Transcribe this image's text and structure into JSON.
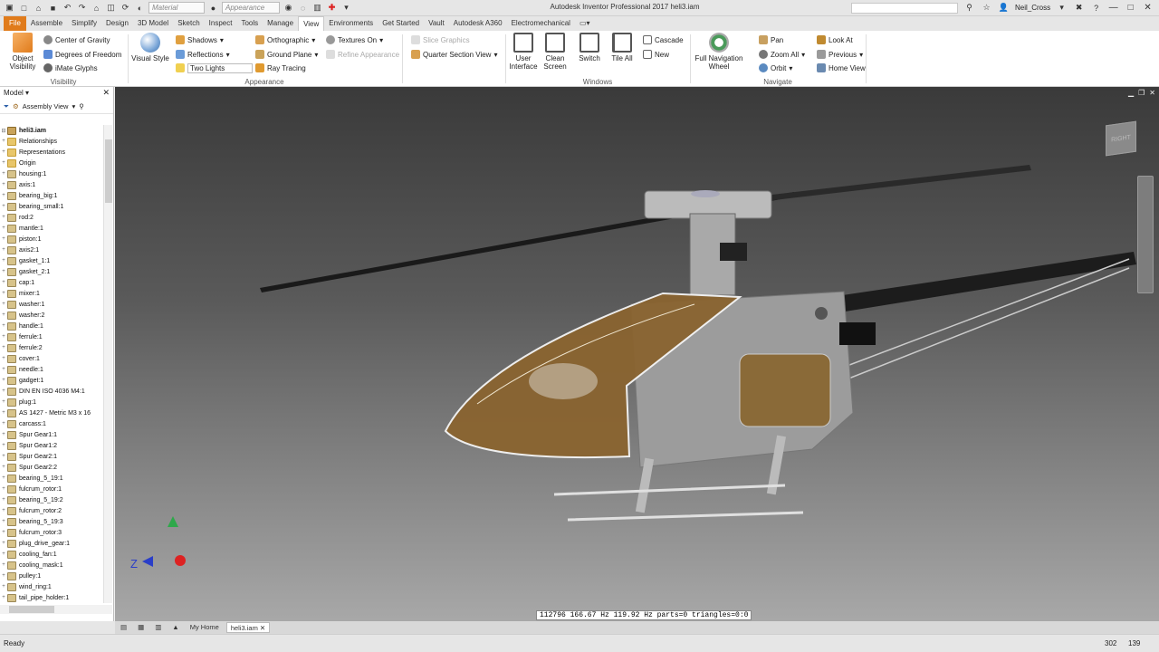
{
  "title_bar": {
    "material_placeholder": "Material",
    "appearance_placeholder": "Appearance",
    "app_title": "Autodesk Inventor Professional 2017    heli3.iam",
    "user_name": "Neil_Cross"
  },
  "menu": {
    "file": "File",
    "tabs": [
      "Assemble",
      "Simplify",
      "Design",
      "3D Model",
      "Sketch",
      "Inspect",
      "Tools",
      "Manage",
      "View",
      "Environments",
      "Get Started",
      "Vault",
      "Autodesk A360",
      "Electromechanical"
    ]
  },
  "ribbon": {
    "visibility": {
      "object_visibility": "Object Visibility",
      "center_of_gravity": "Center of Gravity",
      "degrees_of_freedom": "Degrees of Freedom",
      "imate_glyphs": "iMate Glyphs",
      "group": "Visibility"
    },
    "appearance": {
      "visual_style": "Visual Style",
      "shadows": "Shadows",
      "reflections": "Reflections",
      "two_lights": "Two Lights",
      "orthographic": "Orthographic",
      "ground_plane": "Ground Plane",
      "ray_tracing": "Ray Tracing",
      "textures_on": "Textures On",
      "refine_appearance": "Refine Appearance",
      "group": "Appearance"
    },
    "slice": {
      "slice_graphics": "Slice Graphics",
      "quarter_section": "Quarter Section View"
    },
    "windows": {
      "user_interface": "User Interface",
      "clean_screen": "Clean Screen",
      "switch": "Switch",
      "tile_all": "Tile All",
      "cascade": "Cascade",
      "new": "New",
      "group": "Windows"
    },
    "navigate": {
      "full_nav_wheel": "Full Navigation Wheel",
      "pan": "Pan",
      "zoom_all": "Zoom All",
      "orbit": "Orbit",
      "look_at": "Look At",
      "previous": "Previous",
      "home_view": "Home View",
      "group": "Navigate"
    }
  },
  "model_panel": {
    "title": "Model",
    "view_name": "Assembly View",
    "root": "heli3.iam",
    "items": [
      {
        "label": "Relationships",
        "icon": "folder"
      },
      {
        "label": "Representations",
        "icon": "folder"
      },
      {
        "label": "Origin",
        "icon": "folder"
      },
      {
        "label": "housing:1",
        "icon": "part"
      },
      {
        "label": "axis:1",
        "icon": "part"
      },
      {
        "label": "bearing_big:1",
        "icon": "part"
      },
      {
        "label": "bearing_small:1",
        "icon": "part"
      },
      {
        "label": "rod:2",
        "icon": "part"
      },
      {
        "label": "mantle:1",
        "icon": "part"
      },
      {
        "label": "piston:1",
        "icon": "part"
      },
      {
        "label": "axis2:1",
        "icon": "part"
      },
      {
        "label": "gasket_1:1",
        "icon": "part"
      },
      {
        "label": "gasket_2:1",
        "icon": "part"
      },
      {
        "label": "cap:1",
        "icon": "part"
      },
      {
        "label": "mixer:1",
        "icon": "part"
      },
      {
        "label": "washer:1",
        "icon": "part"
      },
      {
        "label": "washer:2",
        "icon": "part"
      },
      {
        "label": "handle:1",
        "icon": "part"
      },
      {
        "label": "ferrule:1",
        "icon": "part"
      },
      {
        "label": "ferrule:2",
        "icon": "part"
      },
      {
        "label": "cover:1",
        "icon": "part"
      },
      {
        "label": "needle:1",
        "icon": "part"
      },
      {
        "label": "gadget:1",
        "icon": "part"
      },
      {
        "label": "DIN EN ISO 4036 M4:1",
        "icon": "part"
      },
      {
        "label": "plug:1",
        "icon": "part"
      },
      {
        "label": "AS 1427 - Metric M3 x 16",
        "icon": "part"
      },
      {
        "label": "carcass:1",
        "icon": "part"
      },
      {
        "label": "Spur Gear1:1",
        "icon": "part"
      },
      {
        "label": "Spur Gear1:2",
        "icon": "part"
      },
      {
        "label": "Spur Gear2:1",
        "icon": "part"
      },
      {
        "label": "Spur Gear2:2",
        "icon": "part"
      },
      {
        "label": "bearing_5_19:1",
        "icon": "part"
      },
      {
        "label": "fulcrum_rotor:1",
        "icon": "part"
      },
      {
        "label": "bearing_5_19:2",
        "icon": "part"
      },
      {
        "label": "fulcrum_rotor:2",
        "icon": "part"
      },
      {
        "label": "bearing_5_19:3",
        "icon": "part"
      },
      {
        "label": "fulcrum_rotor:3",
        "icon": "part"
      },
      {
        "label": "plug_drive_gear:1",
        "icon": "part"
      },
      {
        "label": "cooling_fan:1",
        "icon": "part"
      },
      {
        "label": "cooling_mask:1",
        "icon": "part"
      },
      {
        "label": "pulley:1",
        "icon": "part"
      },
      {
        "label": "wind_ring:1",
        "icon": "part"
      },
      {
        "label": "tail_pipe_holder:1",
        "icon": "part"
      }
    ]
  },
  "viewport": {
    "viewcube_label": "RIGHT",
    "axis_z": "Z",
    "stats": "112796 166.67 Hz 119.92 Hz  parts=0 triangles=0:0"
  },
  "doc_tabs": {
    "home": "My Home",
    "file": "heli3.iam"
  },
  "status_bar": {
    "left": "Ready",
    "num1": "302",
    "num2": "139"
  }
}
